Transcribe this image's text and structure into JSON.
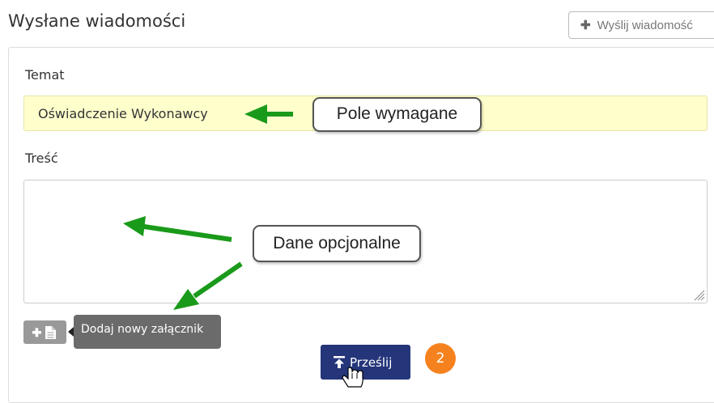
{
  "page": {
    "title": "Wysłane wiadomości",
    "send_new_button": "Wyślij wiadomość"
  },
  "form": {
    "subject_label": "Temat",
    "subject_value": "Oświadczenie Wykonawcy",
    "content_label": "Treść",
    "content_value": "",
    "add_attachment_tooltip": "Dodaj nowy załącznik",
    "submit_label": "Prześlij"
  },
  "annotations": {
    "required_callout": "Pole wymagane",
    "optional_callout": "Dane opcjonalne",
    "step_number": "2",
    "arrow_color": "#1a9a1a"
  },
  "colors": {
    "required_field_bg": "#ffffcc",
    "submit_bg": "#24357a",
    "step_badge": "#f6821f",
    "tooltip_bg": "#6b6b6b"
  },
  "icons": [
    "plus-icon",
    "add-file-icon",
    "upload-icon",
    "hand-cursor-icon",
    "resize-grip-icon",
    "arrow-icon"
  ]
}
